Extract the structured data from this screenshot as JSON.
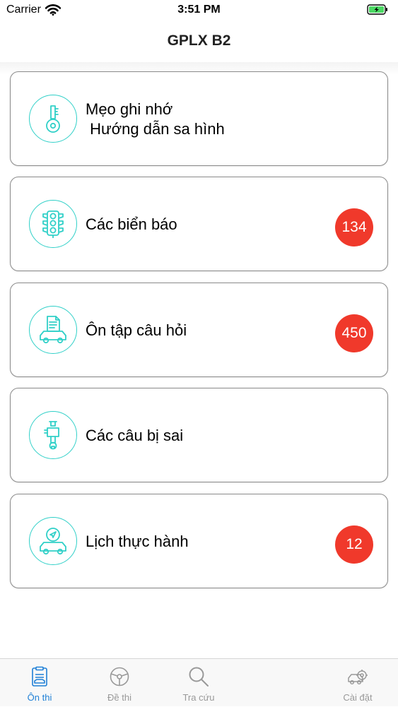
{
  "status_bar": {
    "carrier": "Carrier",
    "time": "3:51 PM"
  },
  "header": {
    "title": "GPLX B2"
  },
  "menu": {
    "items": [
      {
        "line1": "Mẹo ghi nhớ",
        "line2": " Hướng dẫn sa hình",
        "icon": "key-icon"
      },
      {
        "line1": "Các biển báo",
        "badge": "134",
        "icon": "traffic-light-icon"
      },
      {
        "line1": "Ôn tập câu hỏi",
        "badge": "450",
        "icon": "car-document-icon"
      },
      {
        "line1": "Các câu bị sai",
        "icon": "hand-wrench-icon"
      },
      {
        "line1": "Lịch thực hành",
        "badge": "12",
        "icon": "car-navigation-icon"
      }
    ]
  },
  "tab_bar": {
    "tabs": [
      {
        "label": "Ôn thi",
        "icon": "exam-list-icon",
        "active": true
      },
      {
        "label": "Đề thi",
        "icon": "steering-wheel-icon"
      },
      {
        "label": "Tra cứu",
        "icon": "magnifier-icon"
      },
      {
        "label": "Cài đặt",
        "icon": "car-gear-icon"
      }
    ]
  },
  "colors": {
    "accent": "#30d0c8",
    "badge": "#f0392b",
    "tab_active": "#1e7fd6",
    "tab_inactive": "#999999"
  }
}
